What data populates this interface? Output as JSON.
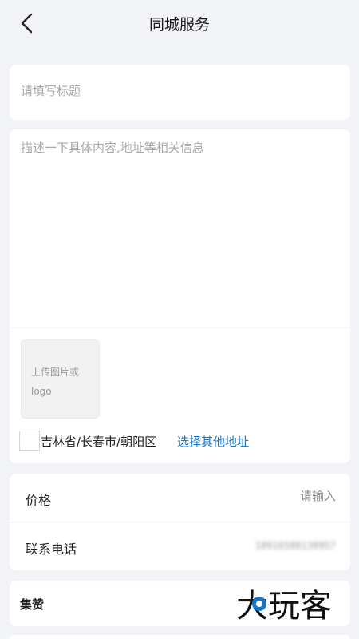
{
  "header": {
    "title": "同城服务"
  },
  "title_field": {
    "placeholder": "请填写标题",
    "value": ""
  },
  "description_field": {
    "placeholder": "描述一下具体内容,地址等相关信息",
    "value": ""
  },
  "upload": {
    "label": "上传图片或logo"
  },
  "location": {
    "current": "吉林省/长春市/朝阳区",
    "change_link": "选择其他地址"
  },
  "form": {
    "price_label": "价格",
    "price_placeholder": "请输入",
    "phone_label": "联系电话",
    "phone_value": "18916588138957"
  },
  "zan": {
    "label": "集赞"
  },
  "watermark": {
    "text": "大玩客"
  },
  "colors": {
    "background": "#f2f3f7",
    "accent": "#1677c9",
    "card": "#ffffff"
  }
}
